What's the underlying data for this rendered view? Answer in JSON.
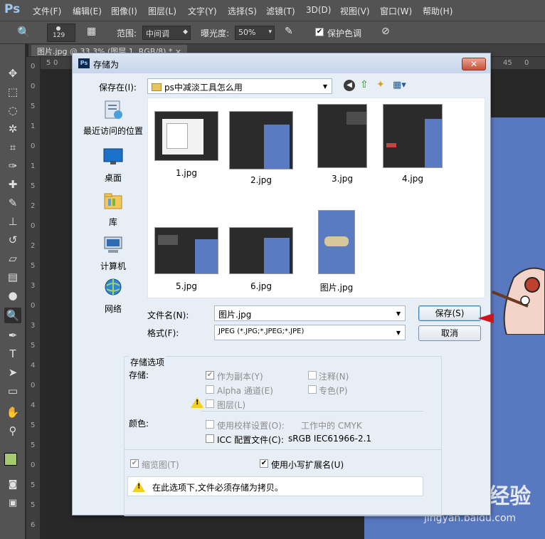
{
  "app": {
    "logo": "Ps",
    "menu": [
      "文件(F)",
      "编辑(E)",
      "图像(I)",
      "图层(L)",
      "文字(Y)",
      "选择(S)",
      "滤镜(T)",
      "3D(D)",
      "视图(V)",
      "窗口(W)",
      "帮助(H)"
    ],
    "options": {
      "brush_size": "129",
      "range_label": "范围:",
      "range_value": "中间调",
      "exposure_label": "曝光度:",
      "exposure_value": "50%",
      "protect_tones": "保护色调"
    },
    "doc_tab": "图片.jpg @ 33.3% (图层 1, RGB/8) * ×",
    "ruler_left": [
      "0",
      "0",
      "5",
      "1",
      "0",
      "1",
      "5",
      "2",
      "0",
      "2",
      "5",
      "3",
      "0",
      "3",
      "5",
      "4",
      "0",
      "4",
      "5",
      "5",
      "0",
      "5",
      "5",
      "6"
    ],
    "ruler_top": [
      "5",
      "0",
      "45",
      "0"
    ],
    "watermark": "Baidu经验",
    "watermark_url": "jingyan.baidu.com"
  },
  "dialog": {
    "title": "存储为",
    "save_in_label": "保存在(I):",
    "save_in_value": "ps中减淡工具怎么用",
    "places": [
      "最近访问的位置",
      "桌面",
      "库",
      "计算机",
      "网络"
    ],
    "files": [
      {
        "name": "1.jpg"
      },
      {
        "name": "2.jpg"
      },
      {
        "name": "3.jpg"
      },
      {
        "name": "4.jpg"
      },
      {
        "name": "5.jpg"
      },
      {
        "name": "6.jpg"
      },
      {
        "name": "图片.jpg"
      }
    ],
    "filename_label": "文件名(N):",
    "filename_value": "图片.jpg",
    "format_label": "格式(F):",
    "format_value": "JPEG (*.JPG;*.JPEG;*.JPE)",
    "save_button": "保存(S)",
    "cancel_button": "取消",
    "options": {
      "group_title": "存储选项",
      "store_label": "存储:",
      "as_copy": "作为副本(Y)",
      "alpha": "Alpha 通道(E)",
      "layers": "图层(L)",
      "annotations": "注释(N)",
      "spot": "专色(P)",
      "color_label": "颜色:",
      "proof": "使用校样设置(O):",
      "proof_value": "工作中的 CMYK",
      "icc": "ICC 配置文件(C):",
      "icc_value": "sRGB IEC61966-2.1",
      "thumbnail": "缩览图(T)",
      "lowercase": "使用小写扩展名(U)",
      "warning": "在此选项下,文件必须存储为拷贝。"
    }
  }
}
